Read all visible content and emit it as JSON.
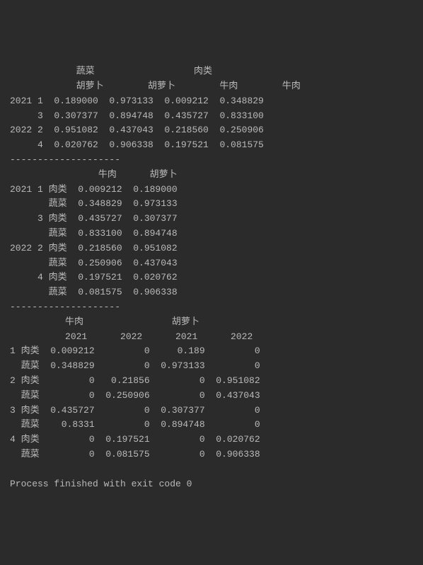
{
  "table1": {
    "header1": "            蔬菜                  肉类",
    "header2": "            胡萝卜        胡萝卜        牛肉        牛肉",
    "rows": [
      "2021 1  0.189000  0.973133  0.009212  0.348829",
      "     3  0.307377  0.894748  0.435727  0.833100",
      "2022 2  0.951082  0.437043  0.218560  0.250906",
      "     4  0.020762  0.906338  0.197521  0.081575"
    ]
  },
  "divider": "--------------------",
  "table2": {
    "header": "                牛肉      胡萝卜",
    "rows": [
      "2021 1 肉类  0.009212  0.189000",
      "       蔬菜  0.348829  0.973133",
      "     3 肉类  0.435727  0.307377",
      "       蔬菜  0.833100  0.894748",
      "2022 2 肉类  0.218560  0.951082",
      "       蔬菜  0.250906  0.437043",
      "     4 肉类  0.197521  0.020762",
      "       蔬菜  0.081575  0.906338"
    ]
  },
  "table3": {
    "header1": "          牛肉                胡萝卜",
    "header2": "          2021      2022      2021      2022",
    "rows": [
      "1 肉类  0.009212         0     0.189         0",
      "  蔬菜  0.348829         0  0.973133         0",
      "2 肉类         0   0.21856         0  0.951082",
      "  蔬菜         0  0.250906         0  0.437043",
      "3 肉类  0.435727         0  0.307377         0",
      "  蔬菜    0.8331         0  0.894748         0",
      "4 肉类         0  0.197521         0  0.020762",
      "  蔬菜         0  0.081575         0  0.906338"
    ]
  },
  "footer": "Process finished with exit code 0"
}
